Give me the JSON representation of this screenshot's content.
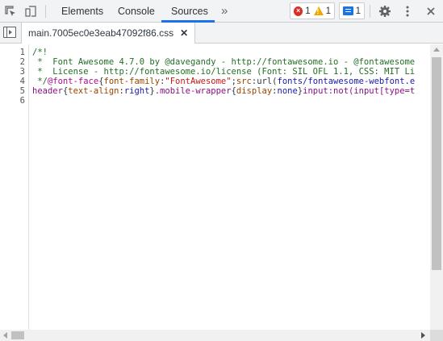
{
  "toolbar": {
    "tabs": [
      {
        "label": "Elements"
      },
      {
        "label": "Console"
      },
      {
        "label": "Sources"
      }
    ],
    "more_tabs": "»",
    "errors_count": "1",
    "warnings_count": "1",
    "issues_count": "1",
    "accent_color": "#1a73e8"
  },
  "editor": {
    "open_file": "main.7005ec0e3eab47092f86.css",
    "close_glyph": "✕",
    "line_numbers": [
      "1",
      "2",
      "3",
      "4",
      "5",
      "6"
    ],
    "lines": {
      "l1": "/*!",
      "l2": " *  Font Awesome 4.7.0 by @davegandy - http://fontawesome.io - @fontawesome",
      "l3": " *  License - http://fontawesome.io/license (Font: SIL OFL 1.1, CSS: MIT Li",
      "l4a": " */",
      "l4b": "@font-face",
      "l4c": "{",
      "l4d": "font-family",
      "l4e": ":",
      "l4f": "\"FontAwesome\"",
      "l4g": ";",
      "l4h": "src",
      "l4i": ":",
      "l4j": "url(",
      "l4k": "fonts/fontawesome-webfont.e",
      "l5a": "header",
      "l5b": "{",
      "l5c": "text-align",
      "l5d": ":",
      "l5e": "right",
      "l5f": "}",
      "l5g": ".mobile-wrapper",
      "l5h": "{",
      "l5i": "display",
      "l5j": ":",
      "l5k": "none",
      "l5l": "}",
      "l5m": "input:not(input[type=t"
    }
  }
}
